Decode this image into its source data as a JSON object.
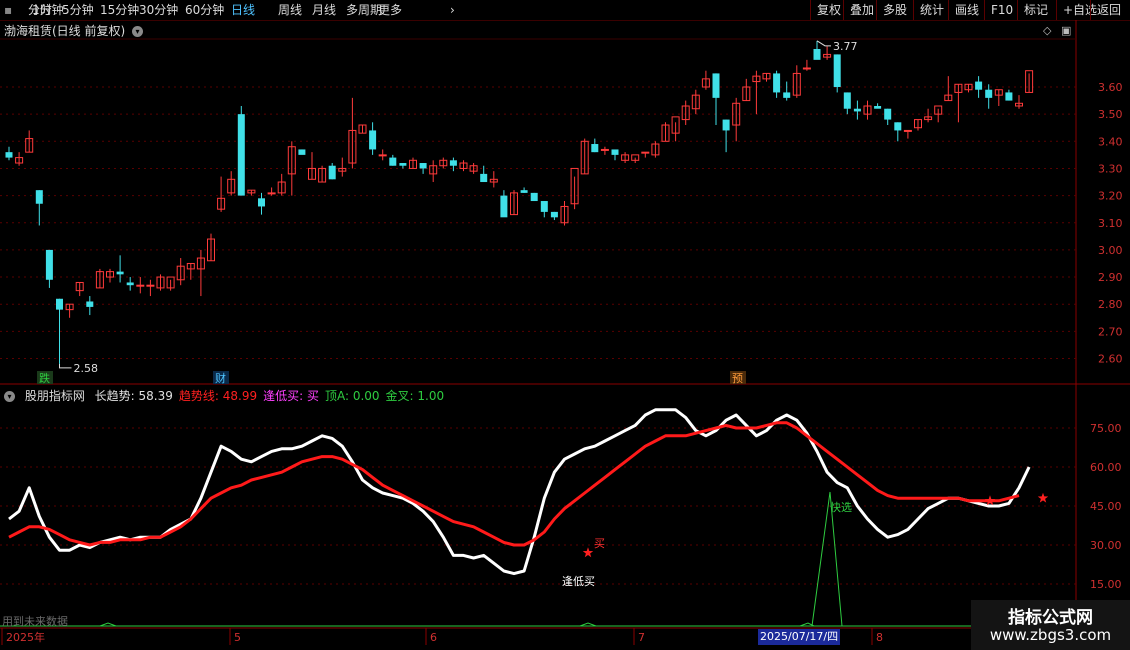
{
  "toolbar": {
    "left_items": [
      "分时",
      "1分钟",
      "5分钟",
      "15分钟",
      "30分钟",
      "60分钟",
      "日线",
      "周线",
      "月线",
      "多周期",
      "更多"
    ],
    "selected": "日线",
    "right_items": [
      "复权",
      "叠加",
      "多股",
      "统计",
      "画线",
      "F10",
      "标记",
      "+自选",
      "返回"
    ]
  },
  "main": {
    "title": "渤海租赁(日线 前复权)",
    "high_marker": "3.77",
    "low_marker": "2.58",
    "events": [
      {
        "label": "跌",
        "color": "#2ecc40",
        "bg": "#1a3a1a"
      },
      {
        "label": "财",
        "color": "#4fc3ff",
        "bg": "#0a2a4a"
      },
      {
        "label": "预",
        "color": "#ff9a3a",
        "bg": "#4a2a0a"
      }
    ],
    "y_ticks": [
      "3.60",
      "3.50",
      "3.40",
      "3.30",
      "3.20",
      "3.10",
      "3.00",
      "2.90",
      "2.80",
      "2.70",
      "2.60"
    ]
  },
  "indicator": {
    "name": "股朋指标网",
    "fields": [
      {
        "label": "长趋势: 58.39",
        "color": "#e0e0e0"
      },
      {
        "label": "趋势线: 48.99",
        "color": "#ff2020"
      },
      {
        "label": "逢低买: 买",
        "color": "#ff40ff"
      },
      {
        "label": "顶A: 0.00",
        "color": "#2ecc40"
      },
      {
        "label": "金叉: 1.00",
        "color": "#2ecc40"
      }
    ],
    "y_ticks": [
      "75.00",
      "60.00",
      "45.00",
      "30.00",
      "15.00"
    ],
    "signal_buy_low": "逢低买",
    "signal_buy": "买",
    "signal_fast": "快选",
    "future_note": "用到未来数据"
  },
  "dates": {
    "year": "2025年",
    "months": [
      "5",
      "6",
      "7",
      "8"
    ],
    "highlight": "2025/07/17/四"
  },
  "watermark": {
    "line1": "指标公式网",
    "line2": "www.zbgs3.com"
  },
  "colors": {
    "up": "#ff3b3b",
    "down": "#40e0e8",
    "trend": "#ff1a1a",
    "long": "#ffffff",
    "grid": "#5a0000"
  },
  "chart_data": {
    "type": "candlestick",
    "series": [
      {
        "name": "candles",
        "ohlc": [
          [
            3.36,
            3.38,
            3.33,
            3.34
          ],
          [
            3.32,
            3.36,
            3.31,
            3.34
          ],
          [
            3.36,
            3.44,
            3.36,
            3.41
          ],
          [
            3.22,
            3.22,
            3.09,
            3.17
          ],
          [
            3.0,
            3.0,
            2.86,
            2.89
          ],
          [
            2.82,
            2.82,
            2.58,
            2.78
          ],
          [
            2.78,
            2.8,
            2.75,
            2.8
          ],
          [
            2.85,
            2.88,
            2.83,
            2.88
          ],
          [
            2.81,
            2.83,
            2.76,
            2.79
          ],
          [
            2.86,
            2.93,
            2.86,
            2.92
          ],
          [
            2.9,
            2.93,
            2.88,
            2.92
          ],
          [
            2.92,
            2.98,
            2.88,
            2.91
          ],
          [
            2.88,
            2.9,
            2.85,
            2.87
          ],
          [
            2.87,
            2.9,
            2.84,
            2.87
          ],
          [
            2.87,
            2.89,
            2.83,
            2.87
          ],
          [
            2.86,
            2.91,
            2.85,
            2.9
          ],
          [
            2.86,
            2.89,
            2.85,
            2.9
          ],
          [
            2.89,
            2.97,
            2.87,
            2.94
          ],
          [
            2.93,
            2.95,
            2.89,
            2.95
          ],
          [
            2.93,
            3.0,
            2.83,
            2.97
          ],
          [
            2.96,
            3.06,
            2.96,
            3.04
          ],
          [
            3.15,
            3.27,
            3.14,
            3.19
          ],
          [
            3.21,
            3.29,
            3.2,
            3.26
          ],
          [
            3.5,
            3.53,
            3.46,
            3.2
          ],
          [
            3.21,
            3.22,
            3.2,
            3.22
          ],
          [
            3.19,
            3.21,
            3.13,
            3.16
          ],
          [
            3.21,
            3.23,
            3.2,
            3.21
          ],
          [
            3.21,
            3.28,
            3.2,
            3.25
          ],
          [
            3.28,
            3.4,
            3.2,
            3.38
          ],
          [
            3.37,
            3.37,
            3.36,
            3.35
          ],
          [
            3.26,
            3.36,
            3.26,
            3.3
          ],
          [
            3.25,
            3.31,
            3.25,
            3.3
          ],
          [
            3.31,
            3.32,
            3.26,
            3.26
          ],
          [
            3.29,
            3.34,
            3.27,
            3.3
          ],
          [
            3.32,
            3.56,
            3.3,
            3.44
          ],
          [
            3.43,
            3.46,
            3.43,
            3.46
          ],
          [
            3.44,
            3.47,
            3.35,
            3.37
          ],
          [
            3.35,
            3.37,
            3.33,
            3.35
          ],
          [
            3.34,
            3.35,
            3.31,
            3.31
          ],
          [
            3.32,
            3.32,
            3.3,
            3.31
          ],
          [
            3.3,
            3.34,
            3.3,
            3.33
          ],
          [
            3.32,
            3.32,
            3.28,
            3.3
          ],
          [
            3.28,
            3.33,
            3.25,
            3.31
          ],
          [
            3.31,
            3.34,
            3.3,
            3.33
          ],
          [
            3.33,
            3.34,
            3.29,
            3.31
          ],
          [
            3.3,
            3.33,
            3.29,
            3.32
          ],
          [
            3.29,
            3.32,
            3.28,
            3.31
          ],
          [
            3.28,
            3.31,
            3.27,
            3.25
          ],
          [
            3.25,
            3.29,
            3.23,
            3.26
          ],
          [
            3.2,
            3.22,
            3.15,
            3.12
          ],
          [
            3.13,
            3.22,
            3.13,
            3.21
          ],
          [
            3.22,
            3.23,
            3.21,
            3.21
          ],
          [
            3.21,
            3.21,
            3.18,
            3.18
          ],
          [
            3.18,
            3.18,
            3.12,
            3.14
          ],
          [
            3.14,
            3.14,
            3.11,
            3.12
          ],
          [
            3.1,
            3.18,
            3.09,
            3.16
          ],
          [
            3.17,
            3.27,
            3.15,
            3.3
          ],
          [
            3.28,
            3.41,
            3.28,
            3.4
          ],
          [
            3.39,
            3.41,
            3.36,
            3.36
          ],
          [
            3.37,
            3.38,
            3.35,
            3.37
          ],
          [
            3.37,
            3.37,
            3.33,
            3.35
          ],
          [
            3.33,
            3.36,
            3.32,
            3.35
          ],
          [
            3.33,
            3.34,
            3.32,
            3.35
          ],
          [
            3.36,
            3.36,
            3.34,
            3.36
          ],
          [
            3.35,
            3.4,
            3.34,
            3.39
          ],
          [
            3.4,
            3.47,
            3.4,
            3.46
          ],
          [
            3.43,
            3.47,
            3.4,
            3.49
          ],
          [
            3.48,
            3.55,
            3.46,
            3.53
          ],
          [
            3.52,
            3.59,
            3.5,
            3.57
          ],
          [
            3.6,
            3.66,
            3.59,
            3.63
          ],
          [
            3.65,
            3.65,
            3.46,
            3.56
          ],
          [
            3.48,
            3.48,
            3.36,
            3.44
          ],
          [
            3.46,
            3.56,
            3.4,
            3.54
          ],
          [
            3.55,
            3.63,
            3.55,
            3.6
          ],
          [
            3.62,
            3.66,
            3.5,
            3.64
          ],
          [
            3.63,
            3.65,
            3.62,
            3.65
          ],
          [
            3.65,
            3.66,
            3.56,
            3.58
          ],
          [
            3.58,
            3.62,
            3.55,
            3.56
          ],
          [
            3.57,
            3.68,
            3.56,
            3.65
          ],
          [
            3.67,
            3.7,
            3.66,
            3.67
          ],
          [
            3.74,
            3.77,
            3.71,
            3.7
          ],
          [
            3.71,
            3.75,
            3.7,
            3.72
          ],
          [
            3.72,
            3.72,
            3.58,
            3.6
          ],
          [
            3.58,
            3.58,
            3.5,
            3.52
          ],
          [
            3.52,
            3.55,
            3.48,
            3.51
          ],
          [
            3.5,
            3.55,
            3.48,
            3.53
          ],
          [
            3.53,
            3.54,
            3.53,
            3.52
          ],
          [
            3.52,
            3.52,
            3.46,
            3.48
          ],
          [
            3.47,
            3.47,
            3.4,
            3.44
          ],
          [
            3.44,
            3.44,
            3.41,
            3.44
          ],
          [
            3.45,
            3.48,
            3.44,
            3.48
          ],
          [
            3.48,
            3.52,
            3.47,
            3.49
          ],
          [
            3.5,
            3.52,
            3.47,
            3.53
          ],
          [
            3.55,
            3.64,
            3.55,
            3.57
          ],
          [
            3.58,
            3.61,
            3.47,
            3.61
          ],
          [
            3.59,
            3.61,
            3.58,
            3.61
          ],
          [
            3.62,
            3.64,
            3.56,
            3.59
          ],
          [
            3.59,
            3.61,
            3.52,
            3.56
          ],
          [
            3.57,
            3.59,
            3.53,
            3.59
          ],
          [
            3.58,
            3.59,
            3.55,
            3.55
          ],
          [
            3.53,
            3.57,
            3.52,
            3.54
          ],
          [
            3.58,
            3.65,
            3.58,
            3.66
          ]
        ]
      }
    ],
    "indicator_series": [
      {
        "name": "长趋势",
        "values": [
          40,
          43,
          52,
          41,
          33,
          28,
          28,
          30,
          29,
          31,
          32,
          33,
          32,
          33,
          33,
          33,
          36,
          38,
          40,
          48,
          58,
          68,
          66,
          63,
          62,
          64,
          66,
          67,
          67,
          68,
          70,
          72,
          71,
          68,
          62,
          55,
          52,
          50,
          49,
          48,
          46,
          43,
          39,
          33,
          26,
          26,
          25,
          26,
          23,
          20,
          19,
          20,
          33,
          48,
          58,
          63,
          65,
          67,
          68,
          70,
          72,
          74,
          76,
          80,
          82,
          82,
          82,
          79,
          74,
          72,
          74,
          78,
          80,
          76,
          72,
          74,
          78,
          80,
          78,
          73,
          66,
          58,
          54,
          52,
          45,
          40,
          36,
          33,
          34,
          36,
          40,
          44,
          46,
          48,
          48,
          47,
          46,
          45,
          45,
          46,
          52,
          60
        ]
      },
      {
        "name": "趋势线",
        "values": [
          33,
          35,
          37,
          37,
          36,
          34,
          32,
          31,
          30,
          31,
          31,
          32,
          32,
          32,
          33,
          33,
          35,
          37,
          40,
          44,
          48,
          50,
          52,
          53,
          55,
          56,
          57,
          58,
          60,
          62,
          63,
          64,
          64,
          63,
          61,
          59,
          56,
          53,
          51,
          49,
          47,
          45,
          43,
          41,
          39,
          38,
          37,
          35,
          33,
          31,
          30,
          30,
          32,
          35,
          40,
          44,
          47,
          50,
          53,
          56,
          59,
          62,
          65,
          68,
          70,
          72,
          72,
          72,
          73,
          74,
          75,
          76,
          75,
          75,
          75,
          76,
          77,
          77,
          75,
          72,
          69,
          66,
          63,
          60,
          57,
          54,
          51,
          49,
          48,
          48,
          48,
          48,
          48,
          48,
          48,
          47,
          47,
          47,
          47,
          48,
          49
        ]
      }
    ]
  }
}
